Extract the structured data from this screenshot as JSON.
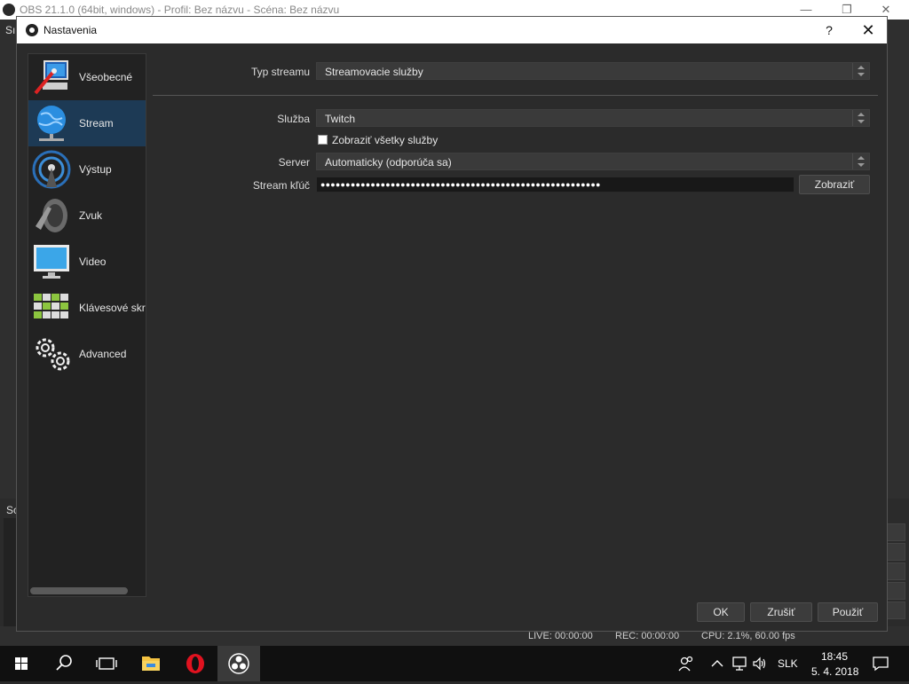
{
  "main_window": {
    "title": "OBS 21.1.0 (64bit, windows) - Profil: Bez názvu - Scéna: Bez názvu",
    "side_letters": [
      "Sı",
      "Sc"
    ],
    "controls": [
      "—",
      "❐",
      "✕"
    ]
  },
  "dialog": {
    "title": "Nastavenia",
    "help": "?",
    "close": "✕"
  },
  "sidebar": {
    "items": [
      {
        "label": "Všeobecné",
        "icon": "general-settings-icon"
      },
      {
        "label": "Stream",
        "icon": "stream-globe-icon",
        "active": true
      },
      {
        "label": "Výstup",
        "icon": "output-broadcast-icon"
      },
      {
        "label": "Zvuk",
        "icon": "audio-speaker-icon"
      },
      {
        "label": "Video",
        "icon": "video-monitor-icon"
      },
      {
        "label": "Klávesové skratky",
        "icon": "hotkeys-keyboard-icon"
      },
      {
        "label": "Advanced",
        "icon": "advanced-gears-icon"
      }
    ]
  },
  "stream": {
    "type_label": "Typ streamu",
    "type_value": "Streamovacie služby",
    "service_label": "Služba",
    "service_value": "Twitch",
    "show_all_label": "Zobraziť všetky služby",
    "show_all_checked": false,
    "server_label": "Server",
    "server_value": "Automaticky (odporúča sa)",
    "key_label": "Stream kľúč",
    "key_masked": "●●●●●●●●●●●●●●●●●●●●●●●●●●●●●●●●●●●●●●●●●●●●●●●●●●●●●●●●",
    "show_button": "Zobraziť"
  },
  "footer": {
    "ok": "OK",
    "cancel": "Zrušiť",
    "apply": "Použiť"
  },
  "statusbar": {
    "live": "LIVE: 00:00:00",
    "rec": "REC: 00:00:00",
    "cpu": "CPU: 2.1%, 60.00 fps"
  },
  "taskbar": {
    "language": "SLK",
    "time": "18:45",
    "date": "5. 4. 2018"
  },
  "colors": {
    "active_item": "#1d3a55",
    "dialog_bg": "#2b2b2b",
    "opera_red": "#e0121f"
  }
}
